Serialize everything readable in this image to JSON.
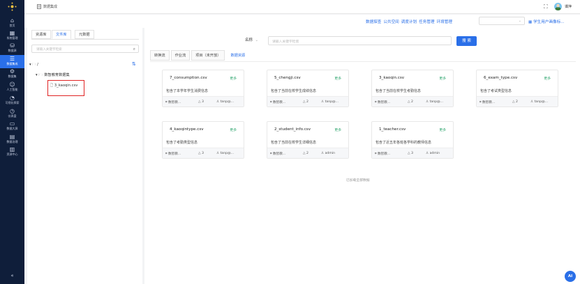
{
  "nav": {
    "items": [
      {
        "label": "首页",
        "icon": "home-icon"
      },
      {
        "label": "系统管理",
        "icon": "grid-icon"
      },
      {
        "label": "数据源",
        "icon": "database-icon"
      },
      {
        "label": "数据集成",
        "icon": "integration-icon",
        "active": true
      },
      {
        "label": "数据集",
        "icon": "dataset-icon"
      },
      {
        "label": "人工智能",
        "icon": "robot-icon"
      },
      {
        "label": "可视化探索",
        "icon": "chart-icon"
      },
      {
        "label": "仪表盘",
        "icon": "gauge-icon"
      },
      {
        "label": "数据大屏",
        "icon": "screen-icon"
      },
      {
        "label": "数据治理",
        "icon": "governance-icon"
      },
      {
        "label": "资源中心",
        "icon": "resource-icon"
      }
    ],
    "collapse_label": "«"
  },
  "topbar": {
    "breadcrumb": "数据集成",
    "fullscreen_icon": "⛶",
    "username": "谭萍"
  },
  "menubar": {
    "links": [
      "数据探查",
      "公共空间",
      "调度计划",
      "任务管理",
      "环境管理"
    ],
    "select_value": "",
    "select_arrow": "⌄",
    "project_label": "学生用户画像标..."
  },
  "left_panel": {
    "tabs": [
      "资源库",
      "文件库",
      "元数据"
    ],
    "active_tab": 1,
    "search_placeholder": "请输入关键字检索",
    "search_icon": "⌕",
    "sort_icon": "⇅",
    "tree": {
      "root": "/",
      "folder": "数智教育数据集",
      "file": "3_kaoqin.csv"
    }
  },
  "main": {
    "search_field": "名称",
    "search_field_arrow": "⌄",
    "search_placeholder": "请输入关键字检索",
    "search_button": "搜 索",
    "tabs": [
      "转换流",
      "作业流",
      "项目（未开放）",
      "数据资源"
    ],
    "active_tab": 3,
    "more_label": "更多",
    "cards": [
      {
        "title": "7_consumption.csv",
        "desc": "包含了本学年学生消费信息",
        "tag": "数智教...",
        "count": "3",
        "user": "tanp@..."
      },
      {
        "title": "5_chengji.csv",
        "desc": "包含了当前在校学生成绩信息",
        "tag": "数智教...",
        "count": "2",
        "user": "tanp@..."
      },
      {
        "title": "3_kaoqin.csv",
        "desc": "包含了当前在校学生考勤信息",
        "tag": "数智教...",
        "count": "2",
        "user": "tanp@..."
      },
      {
        "title": "6_exam_type.csv",
        "desc": "包含了考试类型信息",
        "tag": "数智教...",
        "count": "2",
        "user": "tanp@..."
      },
      {
        "title": "4_kaoqintype.csv",
        "desc": "包含了考勤类型信息",
        "tag": "数智教...",
        "count": "3",
        "user": "tanp@..."
      },
      {
        "title": "2_student_info.csv",
        "desc": "包含了当前在校学生详细信息",
        "tag": "数智教...",
        "count": "2",
        "user": "admin"
      },
      {
        "title": "1_teacher.csv",
        "desc": "包含了近五年各班各学科的教师信息",
        "tag": "数智教...",
        "count": "3",
        "user": "admin"
      }
    ],
    "loaded_text": "已加载全部数据"
  },
  "ai_button": "AI",
  "colors": {
    "accent": "#2a6fe8",
    "nav_bg": "#0f1e3a",
    "more": "#2aa36b",
    "highlight": "#e02424"
  }
}
